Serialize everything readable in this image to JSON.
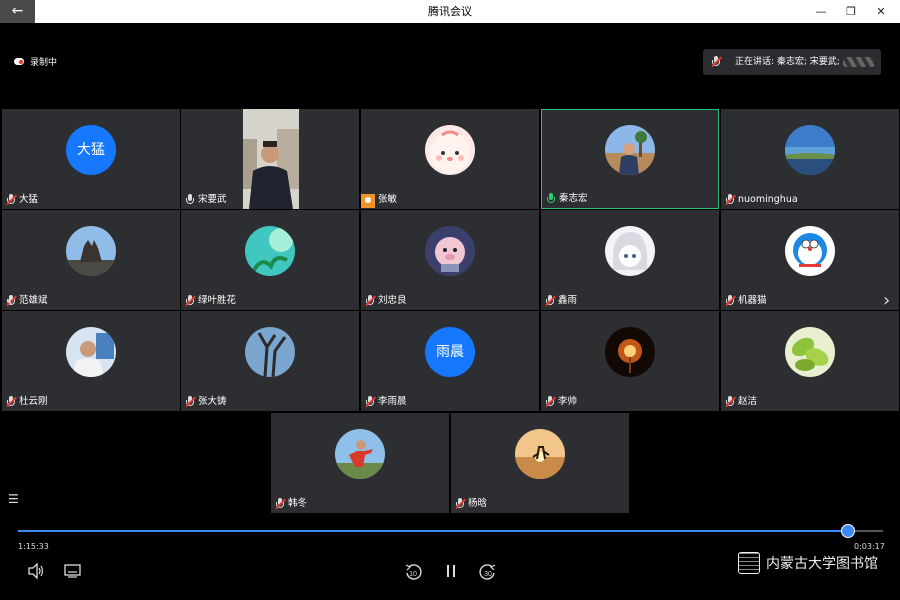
{
  "window": {
    "title": "腾讯会议",
    "back_icon": "←",
    "minimize": "—",
    "maximize": "❐",
    "close": "✕"
  },
  "recording": {
    "label": "录制中"
  },
  "speaking": {
    "label": "正在讲话: 秦志宏; 宋要武;"
  },
  "participants": [
    {
      "name": "大猛",
      "avatar_text": "大猛",
      "mic": "muted"
    },
    {
      "name": "宋要武",
      "mic": "on-white",
      "video": true
    },
    {
      "name": "张敏",
      "mic": "host"
    },
    {
      "name": "秦志宏",
      "mic": "on",
      "active": true
    },
    {
      "name": "nuominghua",
      "mic": "muted"
    },
    {
      "name": "范雄斌",
      "mic": "muted"
    },
    {
      "name": "绿叶胜花",
      "mic": "muted"
    },
    {
      "name": "刘忠良",
      "mic": "muted"
    },
    {
      "name": "鑫雨",
      "mic": "muted"
    },
    {
      "name": "机器猫",
      "mic": "muted"
    },
    {
      "name": "杜云刚",
      "mic": "muted"
    },
    {
      "name": "张大铸",
      "mic": "muted"
    },
    {
      "name": "李雨晨",
      "avatar_text": "雨晨",
      "mic": "muted"
    },
    {
      "name": "李帅",
      "mic": "muted"
    },
    {
      "name": "赵洁",
      "mic": "muted"
    },
    {
      "name": "韩冬",
      "mic": "muted"
    },
    {
      "name": "杨晗",
      "mic": "muted"
    }
  ],
  "player": {
    "elapsed": "1:15:33",
    "remaining": "0:03:17",
    "progress": 0.96,
    "rewind_label": "10",
    "forward_label": "30"
  },
  "watermark": {
    "text": "内蒙古大学图书馆"
  },
  "colors": {
    "accent": "#3d8af7",
    "active_border": "#27c27c",
    "avatar_blue": "#1677ff",
    "host_badge": "#f0932b"
  }
}
